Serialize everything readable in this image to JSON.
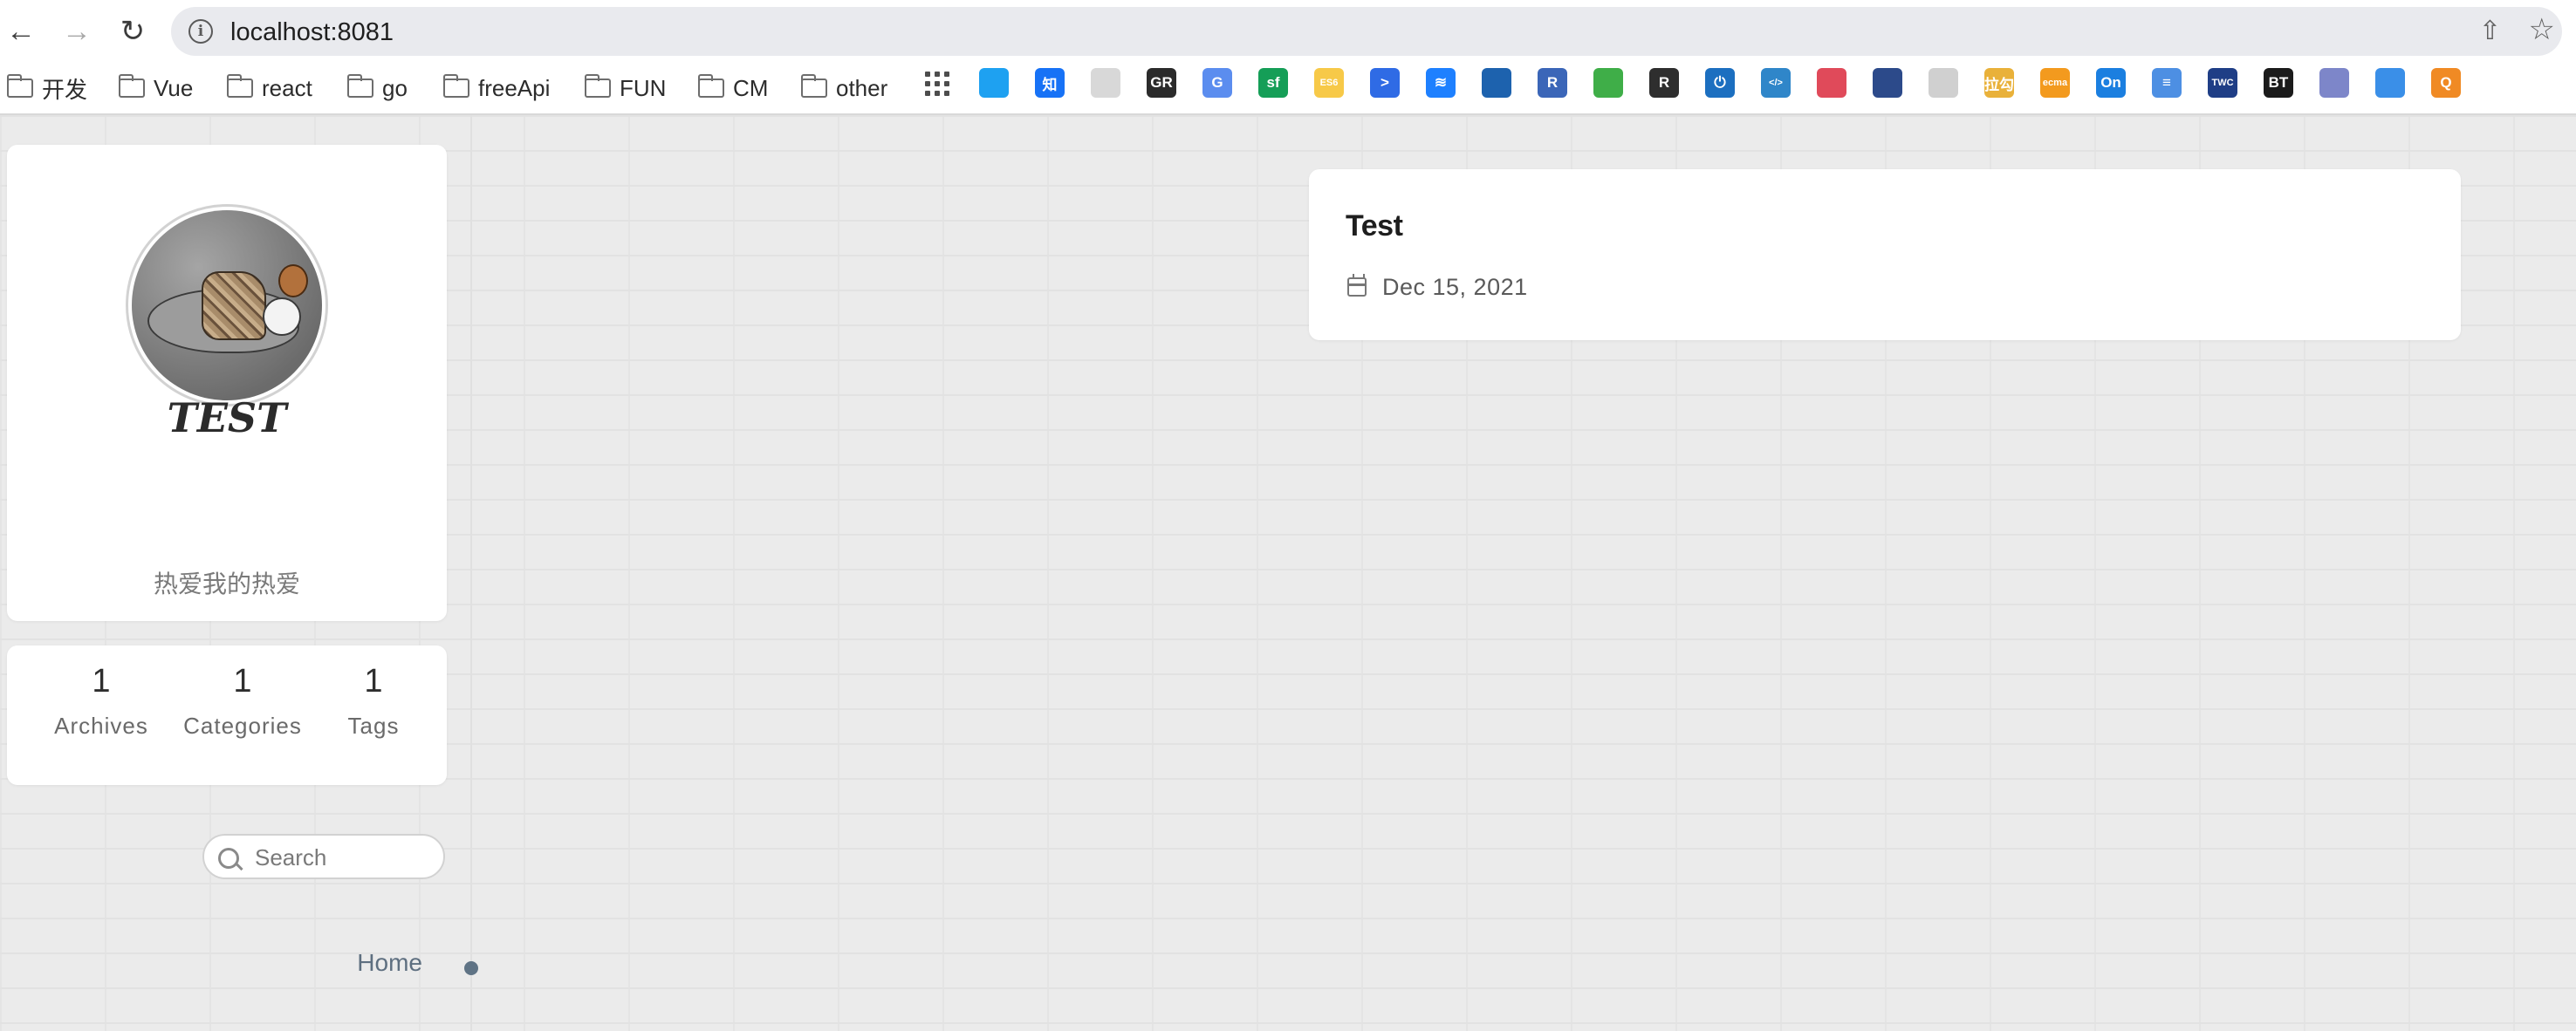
{
  "browser": {
    "url": "localhost:8081",
    "bookmarks": [
      "开发",
      "Vue",
      "react",
      "go",
      "freeApi",
      "FUN",
      "CM",
      "other"
    ],
    "extensions": [
      {
        "name": "bilibili-icon",
        "label": "",
        "color": "#1ea1f1"
      },
      {
        "name": "zhihu-icon",
        "label": "知",
        "color": "#1772f6"
      },
      {
        "name": "github-icon",
        "label": "",
        "color": "#d8d8d8"
      },
      {
        "name": "gr-icon",
        "label": "GR",
        "color": "#2b2b2b"
      },
      {
        "name": "google-translate-icon",
        "label": "G",
        "color": "#5b8def"
      },
      {
        "name": "segmentfault-icon",
        "label": "sf",
        "color": "#159e57"
      },
      {
        "name": "es6-icon",
        "label": "ES6",
        "color": "#f7c948"
      },
      {
        "name": "chevron-icon",
        "label": ">",
        "color": "#2f6be5"
      },
      {
        "name": "juejin-icon",
        "label": "≋",
        "color": "#1e80ff"
      },
      {
        "name": "chart-icon",
        "label": "",
        "color": "#1d62ae"
      },
      {
        "name": "r-icon",
        "label": "R",
        "color": "#3b66b8"
      },
      {
        "name": "leaf-icon",
        "label": "",
        "color": "#3fae48"
      },
      {
        "name": "r-dark-icon",
        "label": "R",
        "color": "#2e2e2e"
      },
      {
        "name": "power-icon",
        "label": "⏻",
        "color": "#1c6fc0"
      },
      {
        "name": "code-icon",
        "label": "</>",
        "color": "#2f86c9"
      },
      {
        "name": "lips-icon",
        "label": "",
        "color": "#e04a5a"
      },
      {
        "name": "lotus-icon",
        "label": "",
        "color": "#2c4a8a"
      },
      {
        "name": "github-gray-icon",
        "label": "",
        "color": "#d0d0d0"
      },
      {
        "name": "lagou-icon",
        "label": "拉勾",
        "color": "#e9b13a"
      },
      {
        "name": "ecma-icon",
        "label": "ecma",
        "color": "#f39a1e"
      },
      {
        "name": "on-icon",
        "label": "On",
        "color": "#1b7fe0"
      },
      {
        "name": "list-icon",
        "label": "≡",
        "color": "#4d8fe3"
      },
      {
        "name": "weather-channel-icon",
        "label": "TWC",
        "color": "#1f3e86"
      },
      {
        "name": "bt-icon",
        "label": "BT",
        "color": "#1b1b1b"
      },
      {
        "name": "cube-icon",
        "label": "",
        "color": "#7d86c9"
      },
      {
        "name": "chat-icon",
        "label": "",
        "color": "#3a8fe8"
      },
      {
        "name": "q-icon",
        "label": "Q",
        "color": "#f08a24"
      }
    ]
  },
  "profile": {
    "name": "TEST",
    "description": "热爱我的热爱"
  },
  "stats": [
    {
      "count": "1",
      "label": "Archives"
    },
    {
      "count": "1",
      "label": "Categories"
    },
    {
      "count": "1",
      "label": "Tags"
    }
  ],
  "search": {
    "placeholder": "Search"
  },
  "menu": {
    "home": "Home"
  },
  "posts": [
    {
      "title": "Test",
      "date": "Dec 15, 2021"
    }
  ]
}
